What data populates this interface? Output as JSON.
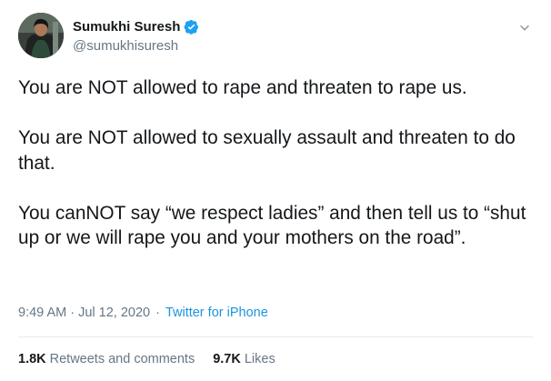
{
  "author": {
    "display_name": "Sumukhi Suresh",
    "handle": "@sumukhisuresh",
    "verified": true,
    "avatar_icon": "profile-photo",
    "verified_icon": "verified-badge-icon",
    "menu_icon": "chevron-down-icon"
  },
  "tweet": {
    "paragraphs": [
      "You are NOT allowed to rape and threaten to rape us.",
      "You are NOT allowed to sexually assault and threaten to do that.",
      "You canNOT say “we respect ladies” and then tell us to “shut up or we will rape you and your mothers on the road”."
    ]
  },
  "meta": {
    "timestamp": "9:49 AM · Jul 12, 2020",
    "separator": "·",
    "source": "Twitter for iPhone"
  },
  "stats": {
    "retweets_count": "1.8K",
    "retweets_label": "Retweets and comments",
    "likes_count": "9.7K",
    "likes_label": "Likes"
  },
  "colors": {
    "text": "#14171a",
    "secondary": "#657786",
    "link": "#1b95e0",
    "verified": "#1da1f2",
    "divider": "#e6ecf0"
  }
}
